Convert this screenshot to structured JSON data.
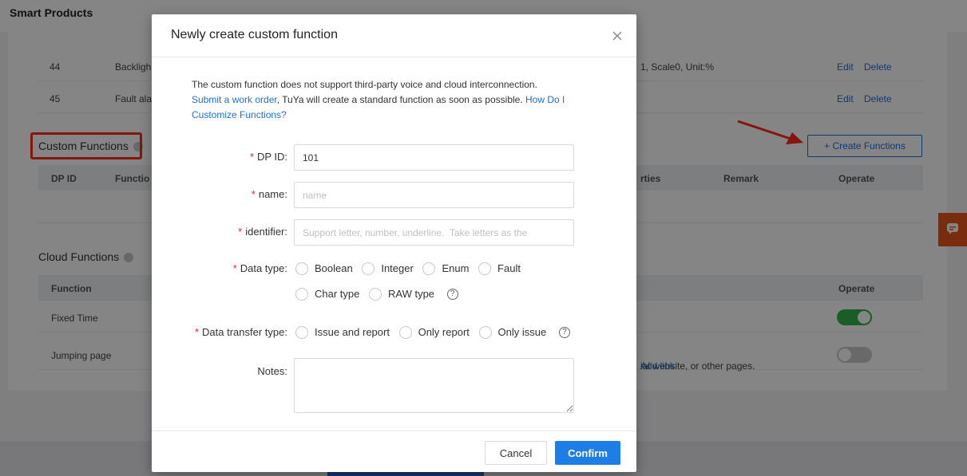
{
  "page": {
    "title": "Smart Products",
    "rows": [
      {
        "dp_id": "44",
        "function": "Backligh",
        "properties": "1, Scale0, Unit:%",
        "edit": "Edit",
        "delete": "Delete"
      },
      {
        "dp_id": "45",
        "function": "Fault ala",
        "properties": "",
        "edit": "Edit",
        "delete": "Delete"
      }
    ],
    "custom_functions": {
      "title": "Custom Functions",
      "create_button": "+ Create Functions",
      "headers": {
        "dp_id": "DP ID",
        "function": "Functio",
        "properties": "rties",
        "remark": "Remark",
        "operate": "Operate"
      }
    },
    "cloud_functions": {
      "title": "Cloud Functions",
      "headers": {
        "function": "Function",
        "operate": "Operate"
      },
      "rows": [
        {
          "function": "Fixed Time",
          "description": "",
          "link": "",
          "enabled": true
        },
        {
          "function": "Jumping page",
          "description": "ial website, or other pages.",
          "link": "Add link",
          "enabled": false
        }
      ]
    }
  },
  "modal": {
    "title": "Newly create custom function",
    "notice": {
      "line1": "The custom function does not support third-party voice and cloud interconnection.",
      "work_order_link": "Submit a work order",
      "middle": ", TuYa will create a standard function as soon as possible. ",
      "howto_link": "How Do I Customize Functions?"
    },
    "fields": {
      "dp_id": {
        "label": "DP ID",
        "value": "101"
      },
      "name": {
        "label": "name",
        "placeholder": "name"
      },
      "identifier": {
        "label": "identifier",
        "placeholder": "Support letter, number, underline.  Take letters as the"
      },
      "data_type": {
        "label": "Data type",
        "options": [
          "Boolean",
          "Integer",
          "Enum",
          "Fault",
          "Char type",
          "RAW type"
        ]
      },
      "transfer_type": {
        "label": "Data transfer type",
        "options": [
          "Issue and report",
          "Only report",
          "Only issue"
        ]
      },
      "notes": {
        "label": "Notes"
      }
    },
    "colon": ":",
    "required_mark": "*",
    "help_mark": "?",
    "cancel_label": "Cancel",
    "confirm_label": "Confirm"
  }
}
